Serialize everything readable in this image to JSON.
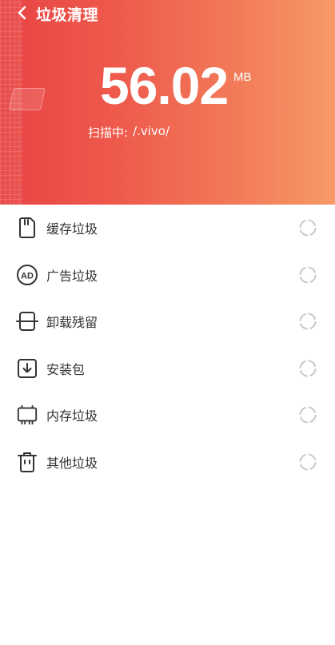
{
  "header": {
    "title": "垃圾清理",
    "total_size": "56.02",
    "unit": "MB",
    "scan_label": "扫描中:",
    "scan_path": "/.vivo/"
  },
  "icons": {
    "back": "chevron-left-icon",
    "cache": "sd-card-icon",
    "ads": "ad-circle-icon",
    "residual": "uninstall-box-icon",
    "apk": "download-box-icon",
    "memory": "memory-chip-icon",
    "other": "trash-icon",
    "loading": "spinner-icon"
  },
  "colors": {
    "header_start": "#e84444",
    "header_end": "#f79a66",
    "icon": "#333333",
    "spinner": "#c8c8c8"
  },
  "categories": [
    {
      "label": "缓存垃圾"
    },
    {
      "label": "广告垃圾"
    },
    {
      "label": "卸载残留"
    },
    {
      "label": "安装包"
    },
    {
      "label": "内存垃圾"
    },
    {
      "label": "其他垃圾"
    }
  ]
}
